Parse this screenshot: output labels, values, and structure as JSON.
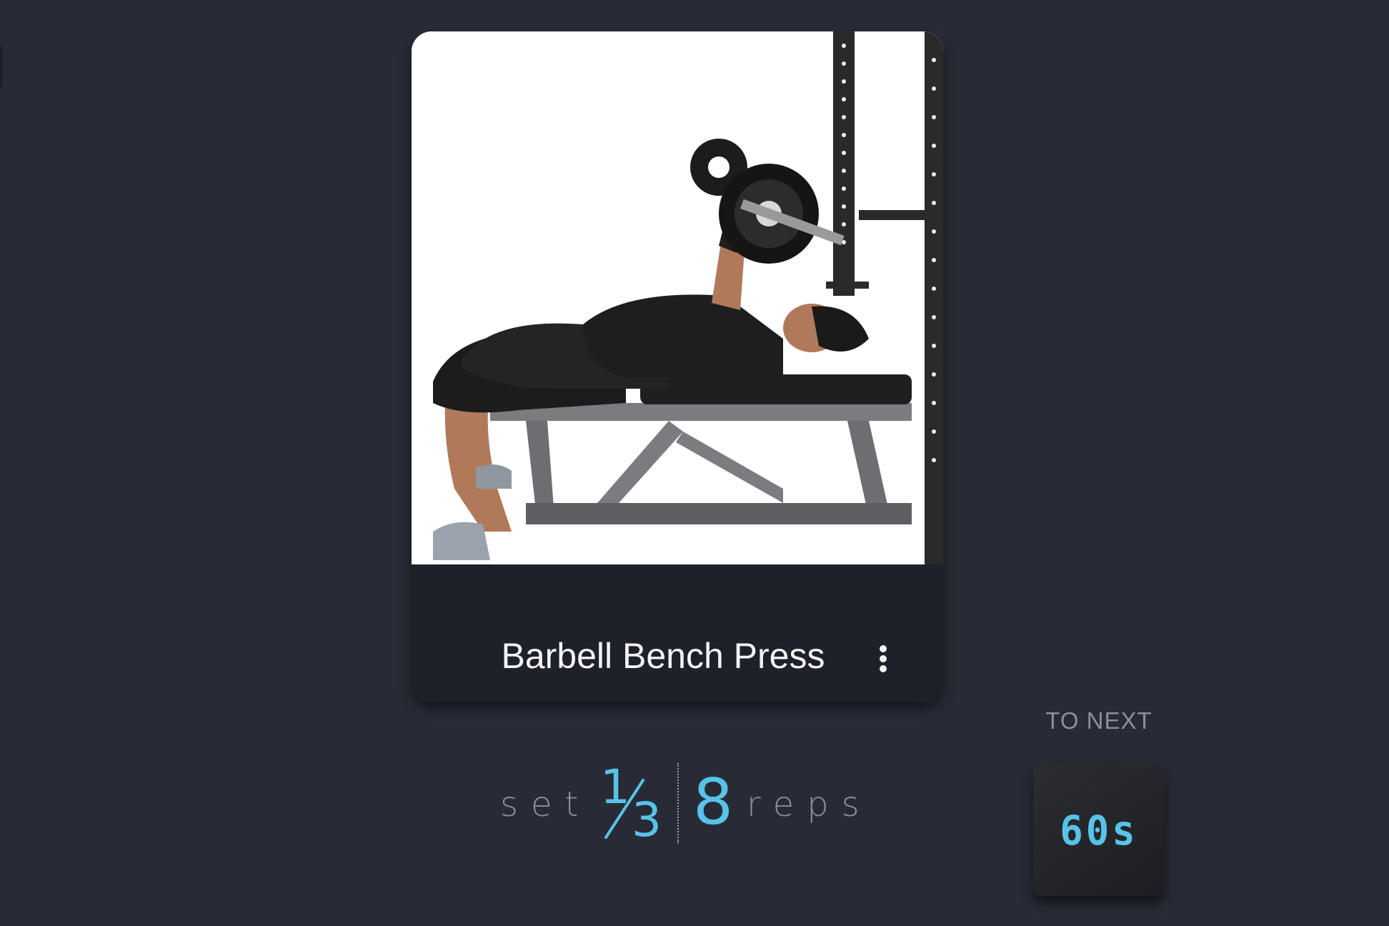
{
  "exercise": {
    "title": "Barbell Bench Press",
    "image_alt": "Woman performing a barbell bench press on a flat bench beside a rack"
  },
  "progress": {
    "set_label": "set",
    "set_current": "1",
    "set_total": "3",
    "reps_count": "8",
    "reps_label": "reps"
  },
  "rest": {
    "label": "TO NEXT",
    "value": "60s"
  },
  "icons": {
    "menu": "more-vertical-icon"
  },
  "colors": {
    "background": "#282b35",
    "card": "#1f212a",
    "accent": "#57c3e8",
    "muted_text": "#8d8f97",
    "title_text": "#f4f4f6"
  }
}
